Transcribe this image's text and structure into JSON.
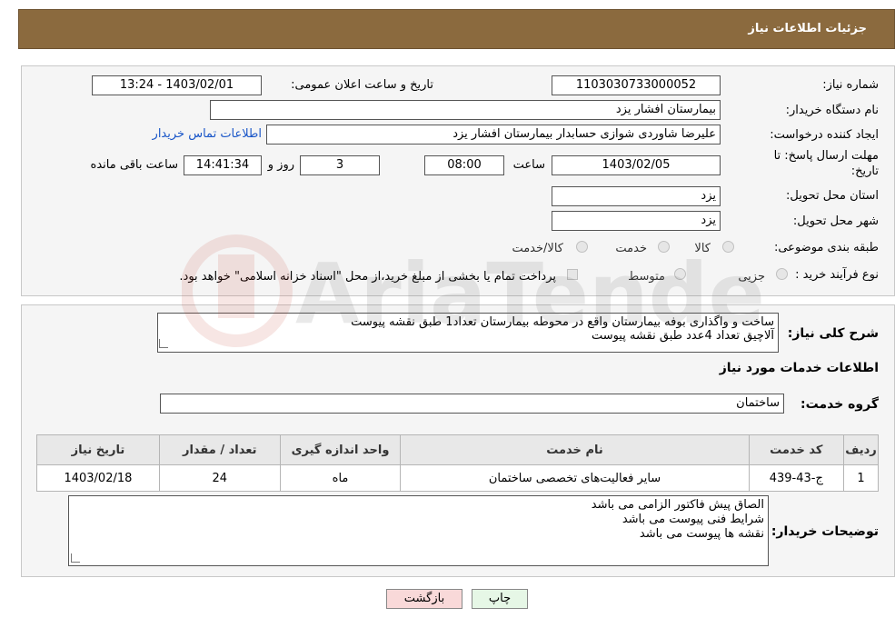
{
  "header": {
    "title": "جزئیات اطلاعات نیاز"
  },
  "form": {
    "need_number_label": "شماره نیاز:",
    "need_number": "1103030733000052",
    "announce_label": "تاریخ و ساعت اعلان عمومی:",
    "announce_value": "1403/02/01 - 13:24",
    "buyer_org_label": "نام دستگاه خریدار:",
    "buyer_org": "بیمارستان افشار یزد",
    "creator_label": "ایجاد کننده درخواست:",
    "creator": "علیرضا شاوردی شوازی حسابدار بیمارستان افشار یزد",
    "contact_link": "اطلاعات تماس خریدار",
    "deadline_label": "مهلت ارسال پاسخ: تا تاریخ:",
    "deadline_date": "1403/02/05",
    "time_label": "ساعت",
    "deadline_time": "08:00",
    "days_value": "3",
    "days_label": "روز و",
    "remaining_time": "14:41:34",
    "remaining_label": "ساعت باقی مانده",
    "province_label": "استان محل تحویل:",
    "province": "یزد",
    "city_label": "شهر محل تحویل:",
    "city": "یزد",
    "category_label": "طبقه بندی موضوعی:",
    "category_options": [
      "کالا",
      "خدمت",
      "کالا/خدمت"
    ],
    "process_label": "نوع فرآیند خرید :",
    "process_options": [
      "جزیی",
      "متوسط"
    ],
    "payment_note": "پرداخت تمام یا بخشی از مبلغ خرید،از محل \"اسناد خزانه اسلامی\" خواهد بود."
  },
  "description": {
    "label": "شرح کلی نیاز:",
    "line1": "ساخت و واگذاری بوفه بیمارستان واقع در محوطه بیمارستان تعداد1 طبق نقشه پیوست",
    "line2": "آلاچیق تعداد 4عدد طبق نقشه پیوست"
  },
  "services": {
    "section_title": "اطلاعات خدمات مورد نیاز",
    "group_label": "گروه خدمت:",
    "group_value": "ساختمان",
    "columns": [
      "ردیف",
      "کد خدمت",
      "نام خدمت",
      "واحد اندازه گیری",
      "تعداد / مقدار",
      "تاریخ نیاز"
    ],
    "rows": [
      [
        "1",
        "ج-43-439",
        "سایر فعالیت‌های تخصصی ساختمان",
        "ماه",
        "24",
        "1403/02/18"
      ]
    ]
  },
  "buyer_notes": {
    "label": "توضیحات خریدار:",
    "line1": "الصاق پیش فاکتور الزامی می باشد",
    "line2": "شرایط فنی پیوست می باشد",
    "line3": "نقشه ها پیوست می باشد"
  },
  "buttons": {
    "print": "چاپ",
    "back": "بازگشت"
  },
  "watermark": {
    "text": "AriaTender.neT"
  },
  "colors": {
    "header_bg": "#8b6a3e",
    "link": "#1a56c8",
    "back_button_bg": "#f9d9d9",
    "print_button_bg": "#e6f7e6"
  }
}
